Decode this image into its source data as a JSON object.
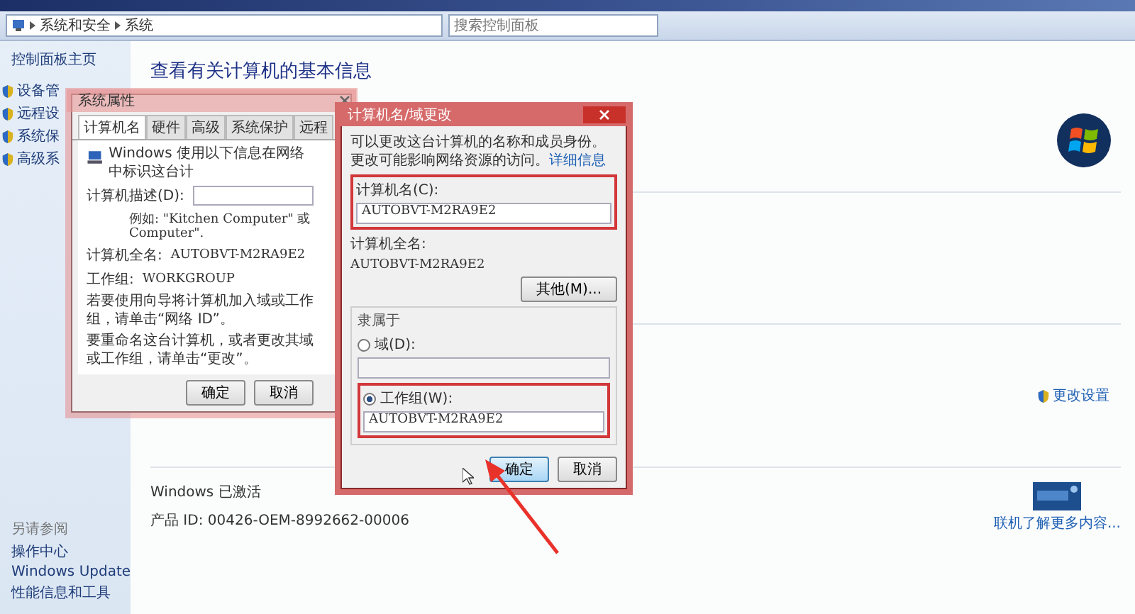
{
  "address_bar": {
    "breadcrumb": [
      "系统和安全",
      "系统"
    ],
    "search": {
      "placeholder": "搜索控制面板"
    }
  },
  "sidebar": {
    "home": "控制面板主页",
    "items": [
      "设备管",
      "远程设",
      "系统保",
      "高级系"
    ],
    "see_also_title": "另请参阅",
    "see_also": [
      "操作中心",
      "Windows Update",
      "性能信息和工具"
    ]
  },
  "main": {
    "title": "查看有关计算机的基本信息",
    "change_settings": "更改设置",
    "activation_status": "Windows 已激活",
    "product_id": "产品 ID: 00426-OEM-8992662-00006",
    "learn_more": "联机了解更多内容..."
  },
  "system_properties": {
    "title": "系统属性",
    "tabs": [
      {
        "label": "计算机名",
        "selected": true
      },
      {
        "label": "硬件",
        "selected": false
      },
      {
        "label": "高级",
        "selected": false
      },
      {
        "label": "系统保护",
        "selected": false
      },
      {
        "label": "远程",
        "selected": false
      }
    ],
    "intro": "Windows 使用以下信息在网络中标识这台计",
    "description_label": "计算机描述(D):",
    "hint_lines": [
      "例如: \"Kitchen Computer\" 或",
      "Computer\"."
    ],
    "fields": [
      {
        "label": "计算机全名:",
        "value": "AUTOBVT-M2RA9E2"
      },
      {
        "label": "工作组:",
        "value": "WORKGROUP"
      }
    ],
    "network_id_text": "若要使用向导将计算机加入域或工作组，请单击“网络 ID”。",
    "rename_text": "要重命名这台计算机，或者更改其域或工作组，请单击“更改”。",
    "buttons": [
      "确定",
      "取消"
    ]
  },
  "computer_name_changes": {
    "title": "计算机名/域更改",
    "intro": "可以更改这台计算机的名称和成员身份。更改可能影响网络资源的访问。",
    "details_link": "详细信息",
    "name_label": "计算机名(C):",
    "name_value": "AUTOBVT-M2RA9E2",
    "full_name_label": "计算机全名:",
    "full_name_value": "AUTOBVT-M2RA9E2",
    "more_button": "其他(M)...",
    "member_of": "隶属于",
    "options": [
      {
        "label": "域(D):",
        "selected": false
      },
      {
        "label": "工作组(W):",
        "selected": true,
        "value": "AUTOBVT-M2RA9E2"
      }
    ],
    "buttons": [
      {
        "label": "确定",
        "focused": true
      },
      {
        "label": "取消",
        "focused": false
      }
    ]
  }
}
